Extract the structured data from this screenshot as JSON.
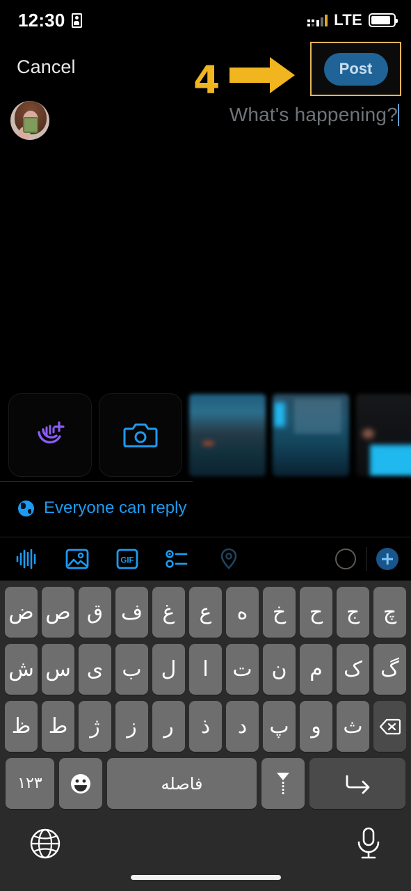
{
  "status_bar": {
    "time": "12:30",
    "sim_icon": "sim-card-icon",
    "network": "LTE",
    "signal_icon": "dual-sim-signal-icon",
    "battery_icon": "battery-icon"
  },
  "nav_bar": {
    "cancel_label": "Cancel",
    "post_label": "Post",
    "post_button_color": "#1f6397",
    "highlight_border_color": "#e4b55c"
  },
  "annotations": {
    "step_number": "4",
    "arrow_icon": "right-arrow-annotation",
    "color": "#f0b51f"
  },
  "compose": {
    "avatar_alt": "user-avatar",
    "placeholder": "?What's happening",
    "caret_color": "#5e9fd4"
  },
  "media_strip": {
    "buttons": [
      {
        "name": "voice-record-button",
        "icon": "voice-add-icon",
        "color": "#8b5cf6"
      },
      {
        "name": "camera-button",
        "icon": "camera-icon",
        "color": "#1d9bf0"
      }
    ],
    "thumbnails": [
      {
        "name": "gallery-thumbnail-1"
      },
      {
        "name": "gallery-thumbnail-2"
      },
      {
        "name": "gallery-thumbnail-3"
      }
    ]
  },
  "reply_setting": {
    "icon": "globe-icon",
    "label": "Everyone can reply",
    "color": "#1d9bf0"
  },
  "toolbar": {
    "items": [
      {
        "name": "audio-waveform-button",
        "icon": "audio-waveform-icon",
        "enabled": true
      },
      {
        "name": "image-button",
        "icon": "image-icon",
        "enabled": true
      },
      {
        "name": "gif-button",
        "icon": "gif-icon",
        "label": "GIF",
        "enabled": true
      },
      {
        "name": "poll-button",
        "icon": "poll-icon",
        "enabled": true
      },
      {
        "name": "location-button",
        "icon": "location-pin-icon",
        "enabled": false
      }
    ],
    "character_ring": "character-count-ring",
    "add_post_button": "add-post-plus-button",
    "accent_color": "#1d9bf0"
  },
  "keyboard": {
    "language": "persian",
    "rows": [
      [
        "ض",
        "ص",
        "ق",
        "ف",
        "غ",
        "ع",
        "ه",
        "خ",
        "ح",
        "ج",
        "چ"
      ],
      [
        "ش",
        "س",
        "ی",
        "ب",
        "ل",
        "ا",
        "ت",
        "ن",
        "م",
        "ک",
        "گ"
      ],
      [
        "ظ",
        "ط",
        "ژ",
        "ز",
        "ر",
        "ذ",
        "د",
        "پ",
        "و",
        "ث"
      ]
    ],
    "backspace_key": "⌫",
    "bottom_row": {
      "numbers_label": "۱۲۳",
      "emoji_icon": "emoji-smiley-icon",
      "space_label": "فاصله",
      "voice_icon": "voice-input-icon",
      "enter_icon": "enter-return-icon"
    }
  },
  "bottom_bar": {
    "globe_icon": "language-globe-icon",
    "mic_icon": "microphone-icon",
    "home_indicator": "home-indicator"
  }
}
